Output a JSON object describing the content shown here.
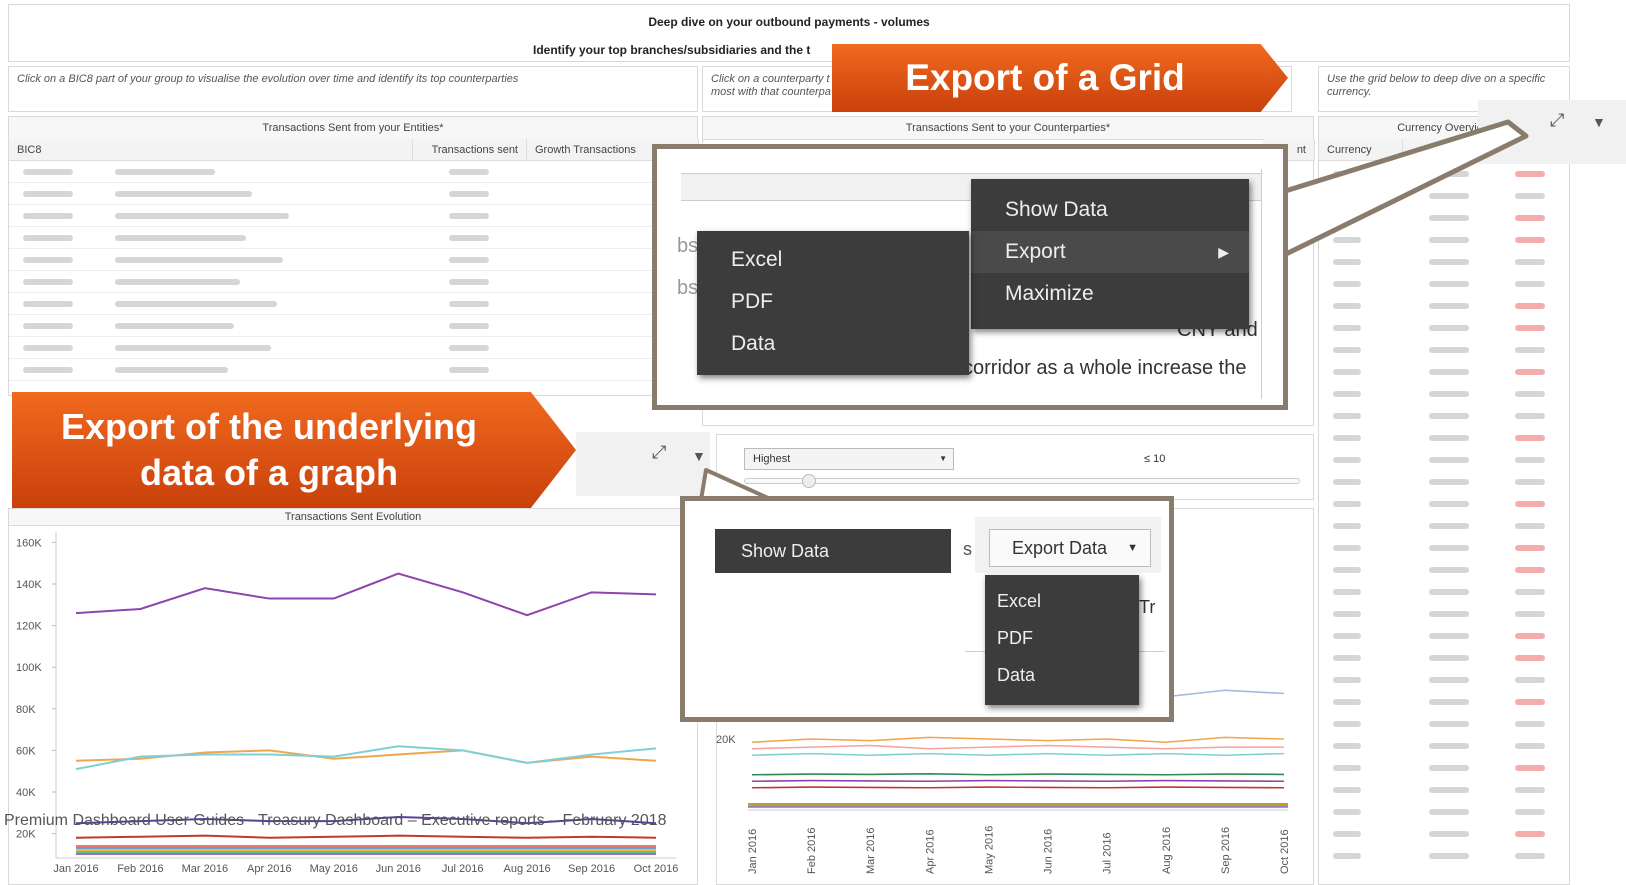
{
  "header": {
    "title": "Deep dive on your outbound payments - volumes",
    "subtitle": "Identify your top branches/subsidiaries and the t"
  },
  "instructions": {
    "left": "Click on a BIC8 part of your group to visualise the evolution over time and identify its top counterparties",
    "middle_line1": "Click on a counterparty t",
    "middle_line2": "most with that counterpa",
    "right": "Use the grid below to deep dive on a specific currency."
  },
  "entities_grid": {
    "title": "Transactions Sent from your Entities*",
    "columns": [
      "BIC8",
      "Transactions sent",
      "Growth Transactions"
    ]
  },
  "counterparties_grid": {
    "title": "Transactions Sent to your Counterparties*",
    "col_fragment": "nt"
  },
  "currency_grid": {
    "title": "Currency Overview",
    "columns": [
      "Currency"
    ]
  },
  "callouts": {
    "grid": "Export of a Grid",
    "graph_line1": "Export of the underlying",
    "graph_line2": "data of a graph"
  },
  "grid_menu": {
    "items": [
      "Show Data",
      "Export",
      "Maximize"
    ],
    "submenu": [
      "Excel",
      "PDF",
      "Data"
    ],
    "bg_text": [
      "bs",
      "bs",
      "CNY and",
      "corridor as a whole increase the"
    ]
  },
  "graph_menu": {
    "show_data": "Show Data",
    "export_button": "Export Data",
    "submenu": [
      "Excel",
      "PDF",
      "Data"
    ],
    "frag_s": "s",
    "frag_tr": "Tr"
  },
  "filter": {
    "select_value": "Highest",
    "range_label": "≤ 10"
  },
  "evolution_chart_title": "Transactions Sent Evolution",
  "chart_data": [
    {
      "type": "line",
      "title": "Transactions Sent Evolution",
      "xlabel": "",
      "ylabel": "",
      "categories": [
        "Jan 2016",
        "Feb 2016",
        "Mar 2016",
        "Apr 2016",
        "May 2016",
        "Jun 2016",
        "Jul 2016",
        "Aug 2016",
        "Sep 2016",
        "Oct 2016"
      ],
      "y_ticks": [
        "160K",
        "140K",
        "120K",
        "100K",
        "80K",
        "60K",
        "40K",
        "20K"
      ],
      "ylim": [
        15000,
        165000
      ],
      "series": [
        {
          "color": "#8e44ad",
          "values": [
            126000,
            128000,
            138000,
            133000,
            133000,
            145000,
            136000,
            125000,
            136000,
            135000
          ]
        },
        {
          "color": "#f0a64f",
          "values": [
            55000,
            56000,
            59000,
            60000,
            56000,
            58000,
            60000,
            54000,
            57000,
            55000
          ]
        },
        {
          "color": "#7fcfd8",
          "values": [
            51000,
            57000,
            58000,
            58000,
            57000,
            62000,
            60000,
            54000,
            58000,
            61000
          ]
        },
        {
          "color": "#5b3e9e",
          "values": [
            25000,
            26000,
            27000,
            26000,
            26000,
            28000,
            27000,
            25000,
            27000,
            25000
          ]
        },
        {
          "color": "#c0392b",
          "values": [
            18000,
            18500,
            19000,
            18000,
            18500,
            19000,
            18500,
            18000,
            18500,
            18000
          ]
        }
      ]
    },
    {
      "type": "line",
      "title": "",
      "xlabel": "",
      "ylabel": "",
      "categories": [
        "Jan 2016",
        "Feb 2016",
        "Mar 2016",
        "Apr 2016",
        "May 2016",
        "Jun 2016",
        "Jul 2016",
        "Aug 2016",
        "Sep 2016",
        "Oct 2016"
      ],
      "y_ticks": [
        "20K"
      ],
      "ylim": [
        0,
        40000
      ],
      "series": [
        {
          "color": "#9fb8df",
          "values": [
            28000,
            29000,
            30000,
            31000,
            30000,
            32000,
            31000,
            33000,
            35000,
            34000
          ]
        },
        {
          "color": "#f0a64f",
          "values": [
            19000,
            20000,
            19500,
            20500,
            20000,
            19500,
            20000,
            19000,
            20500,
            20000
          ]
        },
        {
          "color": "#f5a3a3",
          "values": [
            17000,
            17500,
            18000,
            17000,
            17500,
            18000,
            17500,
            17000,
            17500,
            17500
          ]
        },
        {
          "color": "#7fcfd8",
          "values": [
            15000,
            15500,
            15000,
            15500,
            15000,
            15500,
            15000,
            15500,
            15000,
            15500
          ]
        },
        {
          "color": "#2e8b57",
          "values": [
            9000,
            9200,
            9100,
            9300,
            9000,
            9200,
            9100,
            9000,
            9200,
            9100
          ]
        },
        {
          "color": "#8e44ad",
          "values": [
            7000,
            7200,
            7100,
            7000,
            7200,
            7100,
            7000,
            7200,
            7100,
            7000
          ]
        },
        {
          "color": "#c0392b",
          "values": [
            5000,
            5200,
            5100,
            5000,
            5200,
            5100,
            5000,
            5200,
            5100,
            5000
          ]
        }
      ]
    }
  ],
  "footer": "Premium Dashboard User Guides - Treasury Dashboard – Executive reports – February 2018",
  "colors": {
    "accent": "#e3561a",
    "frame": "#8a7c6d",
    "menu_bg": "#3c3c3c"
  }
}
